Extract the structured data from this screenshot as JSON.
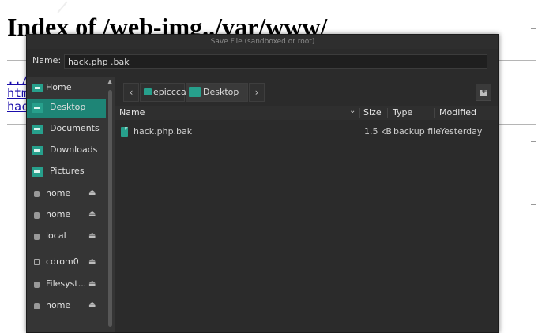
{
  "background_page": {
    "title": "Index of /web-img../var/www/",
    "links": [
      "../",
      "htm",
      "hac"
    ]
  },
  "dialog": {
    "title": "Save File (sandboxed or root)",
    "name_label": "Name:",
    "name_value": "hack.php .bak"
  },
  "sidebar": {
    "items": [
      {
        "label": "Home",
        "icon": "home-folder-icon"
      },
      {
        "label": "Desktop",
        "icon": "desktop-folder-icon",
        "selected": true
      },
      {
        "label": "Documents",
        "icon": "documents-folder-icon"
      },
      {
        "label": "Downloads",
        "icon": "downloads-folder-icon"
      },
      {
        "label": "Pictures",
        "icon": "pictures-folder-icon"
      },
      {
        "label": "home",
        "icon": "drive-icon",
        "eject": true
      },
      {
        "label": "home",
        "icon": "drive-icon",
        "eject": true
      },
      {
        "label": "local",
        "icon": "drive-icon",
        "eject": true
      },
      {
        "label": "cdrom0",
        "icon": "optical-drive-icon",
        "eject": true
      },
      {
        "label": "Filesyst...",
        "icon": "drive-icon",
        "eject": true
      },
      {
        "label": "home",
        "icon": "drive-icon",
        "eject": true
      }
    ],
    "eject_glyph": "⏏"
  },
  "pathbar": {
    "segments": [
      "epicccal",
      "Desktop"
    ],
    "back_glyph": "‹",
    "next_glyph": "›"
  },
  "columns": {
    "name": "Name",
    "size": "Size",
    "type": "Type",
    "modified": "Modified"
  },
  "files": [
    {
      "name": "hack.php.bak",
      "size": "1.5 kB",
      "type": "backup file",
      "modified": "Yesterday"
    }
  ],
  "colors": {
    "accent": "#1e8576",
    "folder": "#27a08c",
    "dialog_bg": "#2b2b2b",
    "sidebar_bg": "#353535"
  }
}
